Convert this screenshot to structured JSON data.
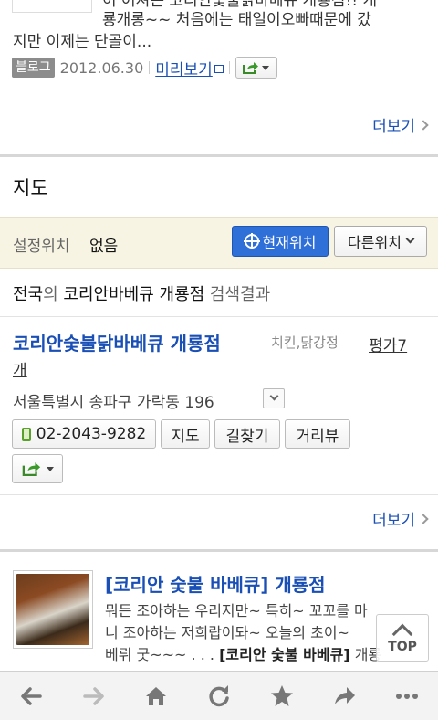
{
  "top_snippet": {
    "cut_line": "이 어져는 코리안숯불닭바베큐 개룡점!! 개",
    "line1": "룡개롱~~ 처음에는 태일이오빠때문에 갔",
    "line2": "지만 이제는 단골이...",
    "badge": "블로그",
    "date": "2012.06.30",
    "preview_label": "미리보기"
  },
  "more_label_1": "더보기",
  "map_section": {
    "title": "지도",
    "location_label": "설정위치",
    "location_value": "없음",
    "current_location_button": "현재위치",
    "other_location_button": "다른위치"
  },
  "search_result": {
    "region": "전국",
    "particle": "의",
    "query": "코리안바베큐 개룡점",
    "suffix": "검색결과"
  },
  "place": {
    "name": "코리안숯불닭바베큐 개룡점",
    "category": "치킨,닭강정",
    "rating_part1": "평가7",
    "rating_part2": "개",
    "address": "서울특별시 송파구 가락동 196",
    "phone": "02-2043-9282",
    "map_button": "지도",
    "route_button": "길찾기",
    "street_button": "거리뷰"
  },
  "more_label_2": "더보기",
  "blog_post": {
    "title": "[코리안 숯불 바베큐] 개룡점",
    "line1": "뭐든 조아하는 우리지만~ 특히~ 꼬꼬를 마",
    "line2": "니 조아하는 저희랍이돠~ 오늘의 초이~",
    "line3_pre": "베뤼 굿~~~ . . . ",
    "line3_bold": "[코리안 숯불 바베큐]",
    "line3_post": " 개룡"
  },
  "top_button_label": "TOP",
  "toolbar": {
    "items": [
      "back-icon",
      "forward-icon",
      "home-icon",
      "refresh-icon",
      "star-icon",
      "share-icon",
      "more-icon"
    ]
  },
  "colors": {
    "link_blue": "#1a4fb5",
    "button_blue": "#2f6fd8",
    "location_bar": "#f7f4e3"
  }
}
